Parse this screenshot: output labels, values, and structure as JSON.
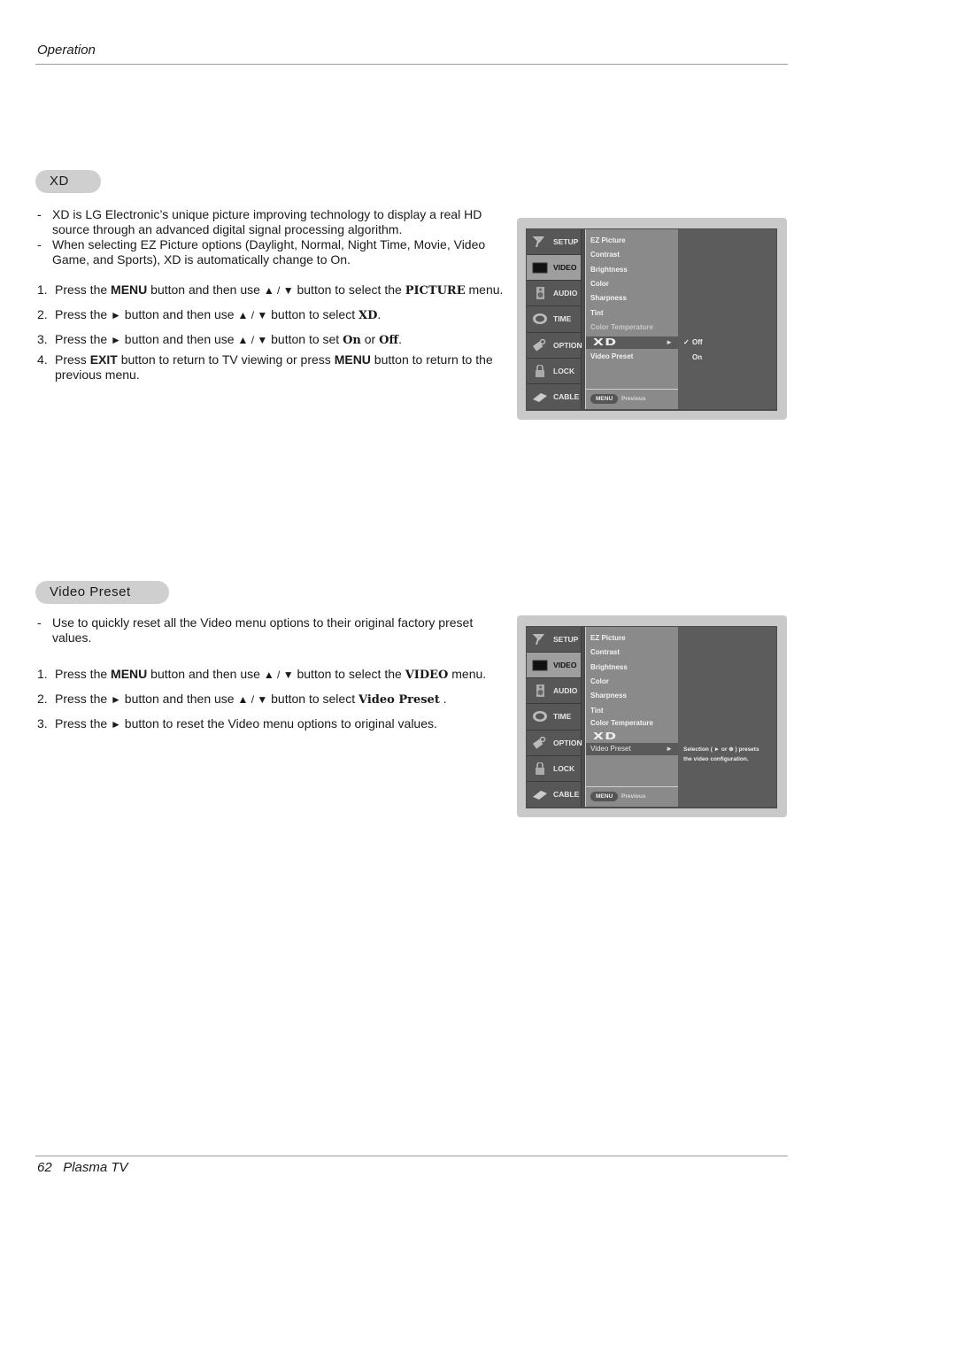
{
  "header": {
    "title": "Operation"
  },
  "footer": {
    "page_number": "62",
    "title": "Plasma TV"
  },
  "xd_section": {
    "title": "XD",
    "bullets": [
      "XD is LG Electronic’s unique picture improving technology to display a real HD source through an advanced digital signal processing algorithm.",
      "When selecting EZ Picture options (Daylight, Normal, Night Time, Movie, Video Game, and Sports), XD is automatically change to On."
    ],
    "steps": [
      {
        "num": "1.",
        "parts": [
          "Press the ",
          "MENU",
          " button and then use ",
          "▲ / ▼",
          " button to select the ",
          "PICTURE",
          " menu."
        ]
      },
      {
        "num": "2.",
        "parts": [
          "Press the ",
          "►",
          " button and then use ",
          "▲ / ▼",
          " button to select ",
          "XD",
          "."
        ]
      },
      {
        "num": "3.",
        "parts": [
          "Press the ",
          "►",
          " button and then use ",
          "▲ / ▼",
          " button to set ",
          "On",
          " or ",
          "Off",
          "."
        ]
      },
      {
        "num": "4.",
        "parts": [
          "Press ",
          "EXIT",
          " button to return to TV viewing or press ",
          "MENU",
          " button to return to the previous menu."
        ]
      }
    ],
    "osd": {
      "sidebar": [
        "SETUP",
        "VIDEO",
        "AUDIO",
        "TIME",
        "OPTION",
        "LOCK",
        "CABLE"
      ],
      "active_sidebar": "VIDEO",
      "menu_items": [
        "EZ Picture",
        "Contrast",
        "Brightness",
        "Color",
        "Sharpness",
        "Tint",
        "Color Temperature",
        "XD",
        "Video Preset"
      ],
      "selected_item": "XD",
      "options": [
        "Off",
        "On"
      ],
      "checked_option": "Off",
      "check_mark": "✓",
      "arrow": "►",
      "menu_button": "MENU",
      "previous_label": "Previous"
    }
  },
  "video_preset_section": {
    "title": "Video Preset",
    "bullets": [
      "Use to quickly reset all the Video menu options to their original factory preset values."
    ],
    "steps": [
      {
        "num": "1.",
        "parts": [
          "Press the ",
          "MENU",
          " button and then use ",
          "▲ / ▼",
          " button to select the ",
          "VIDEO",
          " menu."
        ]
      },
      {
        "num": "2.",
        "parts": [
          "Press the ",
          "►",
          " button and then use ",
          "▲ / ▼",
          " button to select ",
          "Video Preset",
          " ."
        ]
      },
      {
        "num": "3.",
        "parts": [
          "Press the ",
          "►",
          " button to reset the Video menu options to original values."
        ]
      }
    ],
    "osd": {
      "sidebar": [
        "SETUP",
        "VIDEO",
        "AUDIO",
        "TIME",
        "OPTION",
        "LOCK",
        "CABLE"
      ],
      "active_sidebar": "VIDEO",
      "menu_items": [
        "EZ Picture",
        "Contrast",
        "Brightness",
        "Color",
        "Sharpness",
        "Tint",
        "Color Temperature",
        "XD",
        "Video Preset"
      ],
      "selected_item": "Video Preset",
      "help_line1": "Selection ( ► or ⊛ ) presets",
      "help_line2": "the video configuration.",
      "arrow": "►",
      "menu_button": "MENU",
      "previous_label": "Previous"
    }
  }
}
